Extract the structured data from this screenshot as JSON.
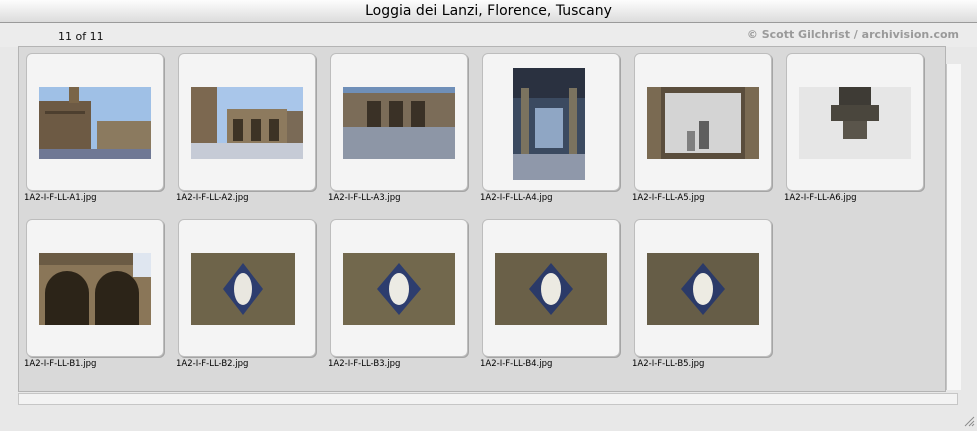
{
  "window": {
    "title": "Loggia dei Lanzi, Florence, Tuscany"
  },
  "header": {
    "count": "11 of 11",
    "credit": "© Scott Gilchrist / archivision.com"
  },
  "thumbnails": [
    {
      "filename": "1A2-I-F-LL-A1.jpg"
    },
    {
      "filename": "1A2-I-F-LL-A2.jpg"
    },
    {
      "filename": "1A2-I-F-LL-A3.jpg"
    },
    {
      "filename": "1A2-I-F-LL-A4.jpg"
    },
    {
      "filename": "1A2-I-F-LL-A5.jpg"
    },
    {
      "filename": "1A2-I-F-LL-A6.jpg"
    },
    {
      "filename": "1A2-I-F-LL-B1.jpg"
    },
    {
      "filename": "1A2-I-F-LL-B2.jpg"
    },
    {
      "filename": "1A2-I-F-LL-B3.jpg"
    },
    {
      "filename": "1A2-I-F-LL-B4.jpg"
    },
    {
      "filename": "1A2-I-F-LL-B5.jpg"
    }
  ],
  "icons": {
    "resize": "resize-grip-icon"
  },
  "colors": {
    "panel": "#d9d9d9",
    "slide": "#f4f4f4",
    "credit": "#9a9a9a"
  }
}
